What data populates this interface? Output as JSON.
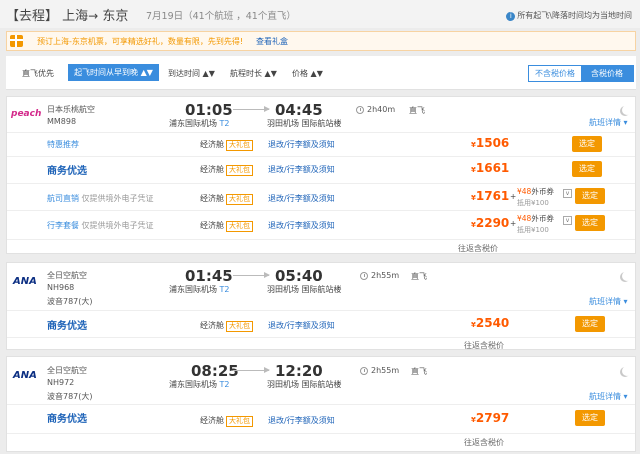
{
  "header": {
    "route_title": "【去程】 上海",
    "arrow": "→",
    "destination": " 东京",
    "date_info": "7月19日（41个航班 ，41个直飞）",
    "tz_note": "所有起飞\\降落时间均为当地时间",
    "info_glyph": "i"
  },
  "promo": {
    "text": "预订上海-东京机票，可享精选好礼，数量有限，先到先得!",
    "link": "查看礼盒"
  },
  "sortbar": {
    "direct_first": "直飞优先",
    "active_sort": "起飞时间从早到晚 ▲▼",
    "arrival_time": "到达时间 ▲▼",
    "duration": "航程时长 ▲▼",
    "price": "价格 ▲▼",
    "toggle_excl": "不含税价格",
    "toggle_incl": "含税价格"
  },
  "common": {
    "cabin": "经济舱",
    "gift": "大礼包",
    "policy": "退改/行李额及须知",
    "book": "选定",
    "yen": "¥",
    "tax_note": "往返含税价",
    "detail_link": "航班详情 ▾",
    "direct": "直飞",
    "plus": "+"
  },
  "flights": [
    {
      "logo": "peach",
      "airline": "日本乐桃航空",
      "flight_no": "MM898",
      "aircraft": "",
      "dep_time": "01:05",
      "dep_airport": "浦东国际机场",
      "dep_terminal": "T2",
      "arr_time": "04:45",
      "arr_airport": "羽田机场 国际航站楼",
      "duration": "2h40m",
      "fares": [
        {
          "name": "特惠推荐",
          "note": "",
          "price": "1506",
          "coupon_amount": "",
          "coupon_label": "",
          "coupon_sub": ""
        },
        {
          "name": "商务优选",
          "note": "",
          "price": "1661",
          "coupon_amount": "",
          "coupon_label": "",
          "coupon_sub": ""
        },
        {
          "name": "航司直销",
          "note": "仅提供境外电子凭证",
          "price": "1761",
          "coupon_amount": "48",
          "coupon_label": "外币券",
          "coupon_sub": "抵用¥100"
        },
        {
          "name": "行李套餐",
          "note": "仅提供境外电子凭证",
          "price": "2290",
          "coupon_amount": "48",
          "coupon_label": "外币券",
          "coupon_sub": "抵用¥100"
        }
      ]
    },
    {
      "logo": "ANA",
      "airline": "全日空航空",
      "flight_no": "NH968",
      "aircraft": "波音787(大)",
      "dep_time": "01:45",
      "dep_airport": "浦东国际机场",
      "dep_terminal": "T2",
      "arr_time": "05:40",
      "arr_airport": "羽田机场 国际航站楼",
      "duration": "2h55m",
      "fares": [
        {
          "name": "商务优选",
          "note": "",
          "price": "2540"
        }
      ]
    },
    {
      "logo": "ANA",
      "airline": "全日空航空",
      "flight_no": "NH972",
      "aircraft": "波音787(大)",
      "dep_time": "08:25",
      "dep_airport": "浦东国际机场",
      "dep_terminal": "T2",
      "arr_time": "12:20",
      "arr_airport": "羽田机场 国际航站楼",
      "duration": "2h55m",
      "fares": [
        {
          "name": "商务优选",
          "note": "",
          "price": "2797"
        }
      ]
    }
  ],
  "colors": {
    "accent": "#3a8dde",
    "orange": "#f39800",
    "price": "#ff5a00",
    "link": "#1e63b8"
  }
}
